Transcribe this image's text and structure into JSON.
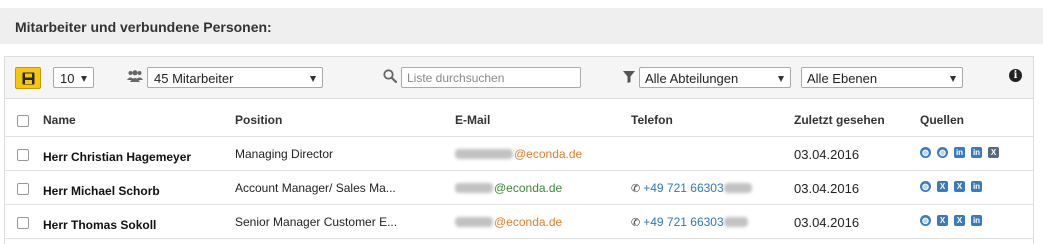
{
  "section": {
    "title": "Mitarbeiter und verbundene Personen:"
  },
  "toolbar": {
    "save_icon": "save-icon",
    "per_page": "10",
    "employee_filter": "45 Mitarbeiter",
    "search_placeholder": "Liste durchsuchen",
    "department_filter": "Alle Abteilungen",
    "level_filter": "Alle Ebenen",
    "info_icon": "info-icon"
  },
  "table": {
    "columns": {
      "name": "Name",
      "position": "Position",
      "email": "E-Mail",
      "phone": "Telefon",
      "last_seen": "Zuletzt gesehen",
      "sources": "Quellen"
    },
    "rows": [
      {
        "name": "Herr Christian Hagemeyer",
        "position": "Managing Director",
        "email_domain": "@econda.de",
        "email_color": "#e37d2b",
        "phone": "",
        "last_seen": "03.04.2016",
        "sources": [
          "globe-icon",
          "globe-icon",
          "linkedin-icon",
          "linkedin-icon",
          "xing-icon"
        ]
      },
      {
        "name": "Herr Michael Schorb",
        "position": "Account Manager/ Sales Ma...",
        "email_domain": "@econda.de",
        "email_color": "#3a8a3a",
        "phone": "+49 721 66303",
        "last_seen": "03.04.2016",
        "sources": [
          "globe-icon",
          "xing-icon",
          "xing-icon",
          "linkedin-icon"
        ]
      },
      {
        "name": "Herr Thomas Sokoll",
        "position": "Senior Manager Customer E...",
        "email_domain": "@econda.de",
        "email_color": "#e37d2b",
        "phone": "+49 721 66303",
        "last_seen": "03.04.2016",
        "sources": [
          "globe-icon",
          "xing-icon",
          "xing-icon",
          "linkedin-icon"
        ]
      }
    ]
  }
}
